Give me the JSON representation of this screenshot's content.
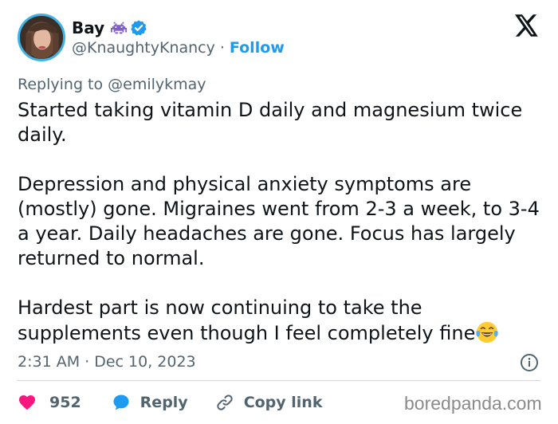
{
  "author": {
    "display_name": "Bay",
    "handle": "@KnaughtyKnancy",
    "separator": "·",
    "follow_label": "Follow"
  },
  "reply_context": "Replying to @emilykmay",
  "tweet": {
    "paragraphs": [
      "Started taking vitamin D daily and magnesium twice daily.",
      "Depression and physical anxiety symptoms are (mostly) gone. Migraines went from 2-3 a week, to 3-4 a year. Daily headaches are gone. Focus has largely returned to normal.",
      "Hardest part is now continuing to take the supplements even though I feel completely fine"
    ]
  },
  "timestamp": "2:31 AM · Dec 10, 2023",
  "actions": {
    "like_count": "952",
    "reply_label": "Reply",
    "copy_link_label": "Copy link"
  },
  "watermark": "boredpanda.com",
  "icons": {
    "avatar": "profile-photo",
    "invader": "space-invader-emoji",
    "verified": "verified-badge-icon",
    "brand": "x-logo",
    "emoji_end": "tears-of-joy-emoji",
    "info": "info-icon",
    "like": "heart-icon",
    "reply": "speech-bubble-icon",
    "copy": "link-icon"
  },
  "colors": {
    "accent": "#1d9bf0",
    "like": "#f91880",
    "text": "#0f1419",
    "muted": "#536471"
  }
}
